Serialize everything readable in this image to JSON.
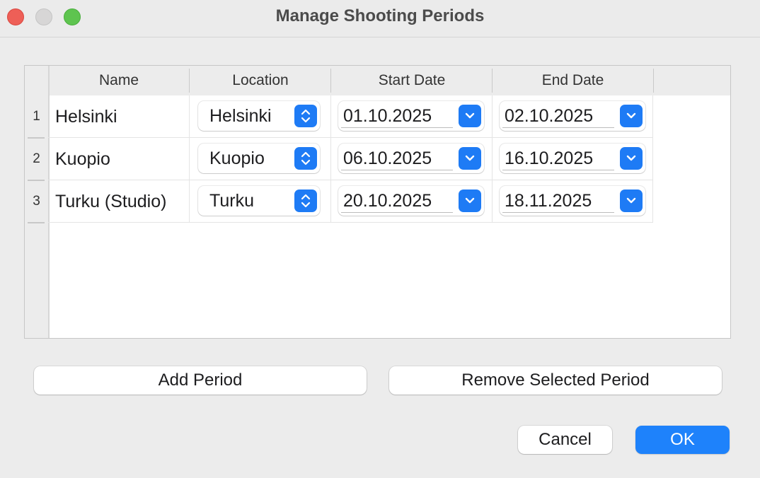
{
  "window": {
    "title": "Manage Shooting Periods"
  },
  "table": {
    "headers": [
      "Name",
      "Location",
      "Start Date",
      "End Date"
    ],
    "rows": [
      {
        "index": "1",
        "name": "Helsinki",
        "location": "Helsinki",
        "start_date": "01.10.2025",
        "end_date": "02.10.2025"
      },
      {
        "index": "2",
        "name": "Kuopio",
        "location": "Kuopio",
        "start_date": "06.10.2025",
        "end_date": "16.10.2025"
      },
      {
        "index": "3",
        "name": "Turku (Studio)",
        "location": "Turku",
        "start_date": "20.10.2025",
        "end_date": "18.11.2025"
      }
    ]
  },
  "buttons": {
    "add": "Add Period",
    "remove": "Remove Selected Period",
    "cancel": "Cancel",
    "ok": "OK"
  },
  "icons": {
    "close": "close-icon",
    "minimize": "minimize-icon",
    "maximize": "maximize-icon",
    "popup_stepper": "chevron-up-down-icon",
    "date_dropdown": "chevron-down-icon"
  },
  "colors": {
    "accent": "#1e7bf5",
    "ok_button": "#1e82fb",
    "close": "#ee5f57",
    "minimize": "#d7d6d6",
    "maximize": "#5ec44f"
  }
}
